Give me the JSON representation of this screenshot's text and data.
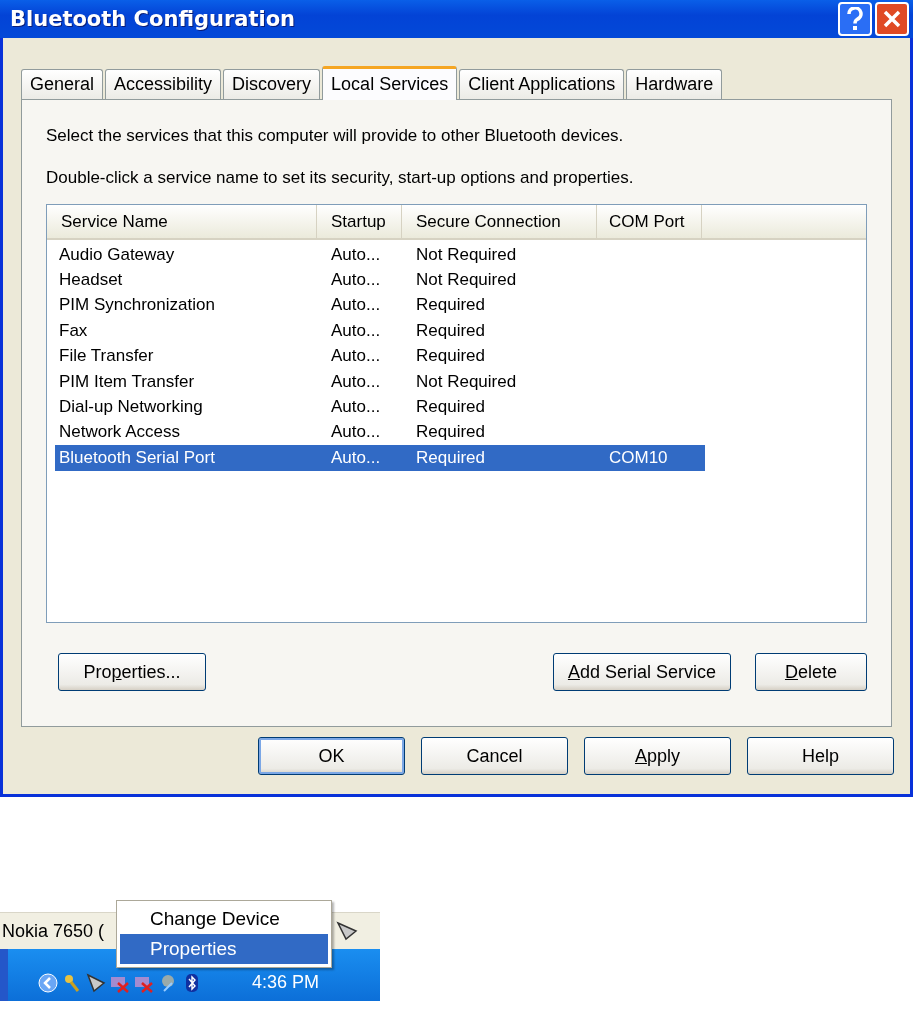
{
  "window": {
    "title": "Bluetooth Configuration"
  },
  "tabs": [
    {
      "label": "General",
      "selected": false
    },
    {
      "label": "Accessibility",
      "selected": false
    },
    {
      "label": "Discovery",
      "selected": false
    },
    {
      "label": "Local Services",
      "selected": true
    },
    {
      "label": "Client Applications",
      "selected": false
    },
    {
      "label": "Hardware",
      "selected": false
    }
  ],
  "instructions": [
    "Select the services that this computer will provide to other Bluetooth devices.",
    "Double-click a service name to set its security, start-up options and properties."
  ],
  "table": {
    "columns": [
      "Service Name",
      "Startup",
      "Secure Connection",
      "COM Port"
    ],
    "rows": [
      {
        "cells": [
          "Audio Gateway",
          "Auto...",
          "Not Required",
          ""
        ],
        "selected": false
      },
      {
        "cells": [
          "Headset",
          "Auto...",
          "Not Required",
          ""
        ],
        "selected": false
      },
      {
        "cells": [
          "PIM Synchronization",
          "Auto...",
          "Required",
          ""
        ],
        "selected": false
      },
      {
        "cells": [
          "Fax",
          "Auto...",
          "Required",
          ""
        ],
        "selected": false
      },
      {
        "cells": [
          "File Transfer",
          "Auto...",
          "Required",
          ""
        ],
        "selected": false
      },
      {
        "cells": [
          "PIM Item Transfer",
          "Auto...",
          "Not Required",
          ""
        ],
        "selected": false
      },
      {
        "cells": [
          "Dial-up Networking",
          "Auto...",
          "Required",
          ""
        ],
        "selected": false
      },
      {
        "cells": [
          "Network Access",
          "Auto...",
          "Required",
          ""
        ],
        "selected": false
      },
      {
        "cells": [
          "Bluetooth Serial Port",
          "Auto...",
          "Required",
          "COM10"
        ],
        "selected": true
      }
    ]
  },
  "panel_buttons": {
    "left": [
      {
        "label_before": "Pro",
        "mnemonic": "p",
        "label_after": "erties..."
      }
    ],
    "right": [
      {
        "mnemonic": "A",
        "label_after": "dd Serial Service"
      },
      {
        "mnemonic": "D",
        "label_after": "elete"
      }
    ]
  },
  "dialog_buttons": [
    {
      "label_after": "OK",
      "default": true
    },
    {
      "label_after": "Cancel",
      "default": false
    },
    {
      "mnemonic": "A",
      "label_after": "pply",
      "default": false
    },
    {
      "label_after": "Help",
      "default": false
    }
  ],
  "taskbar": {
    "device_label": "Nokia 7650 (",
    "clock": "4:36 PM",
    "context_menu": [
      {
        "label": "Change Device",
        "selected": false
      },
      {
        "label": "Properties",
        "selected": true
      }
    ]
  }
}
